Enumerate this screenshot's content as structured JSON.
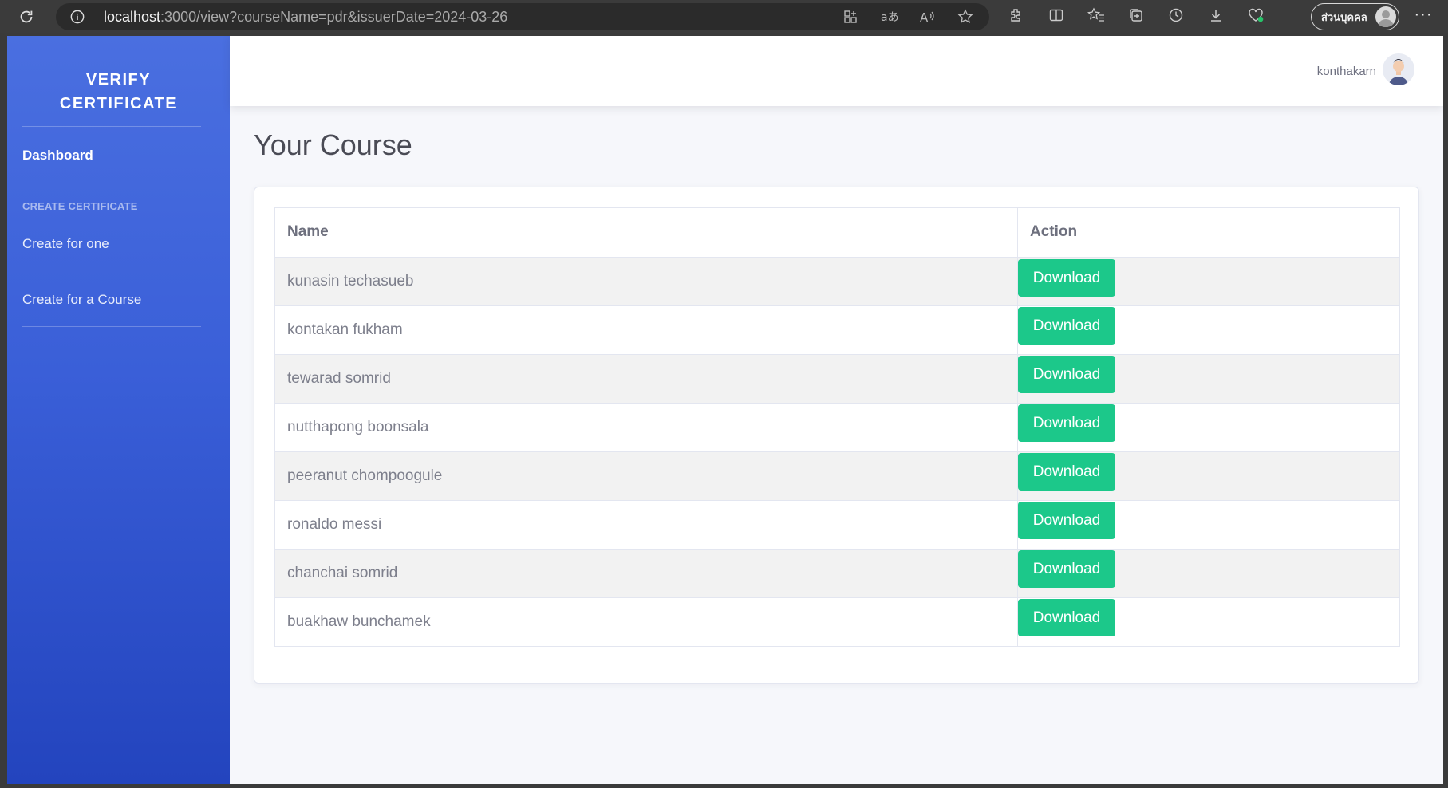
{
  "browser": {
    "url_host": "localhost",
    "url_rest": ":3000/view?courseName=pdr&issuerDate=2024-03-26",
    "profile_label": "ส่วนบุคคล"
  },
  "sidebar": {
    "brand_line1": "VERIFY",
    "brand_line2": "CERTIFICATE",
    "dashboard": "Dashboard",
    "section_heading": "CREATE CERTIFICATE",
    "items": [
      {
        "label": "Create for one"
      },
      {
        "label": "Create for a Course"
      }
    ]
  },
  "topbar": {
    "username": "konthakarn"
  },
  "main": {
    "title": "Your Course",
    "table": {
      "headers": [
        "Name",
        "Action"
      ],
      "button_label": "Download",
      "rows": [
        {
          "name": "kunasin techasueb"
        },
        {
          "name": "kontakan fukham"
        },
        {
          "name": "tewarad somrid"
        },
        {
          "name": "nutthapong boonsala"
        },
        {
          "name": "peeranut chompoogule"
        },
        {
          "name": "ronaldo messi"
        },
        {
          "name": "chanchai somrid"
        },
        {
          "name": "buakhaw bunchamek"
        }
      ]
    }
  },
  "colors": {
    "sidebar_top": "#4a6fe0",
    "sidebar_bottom": "#2344be",
    "success_button": "#1cc88a"
  }
}
